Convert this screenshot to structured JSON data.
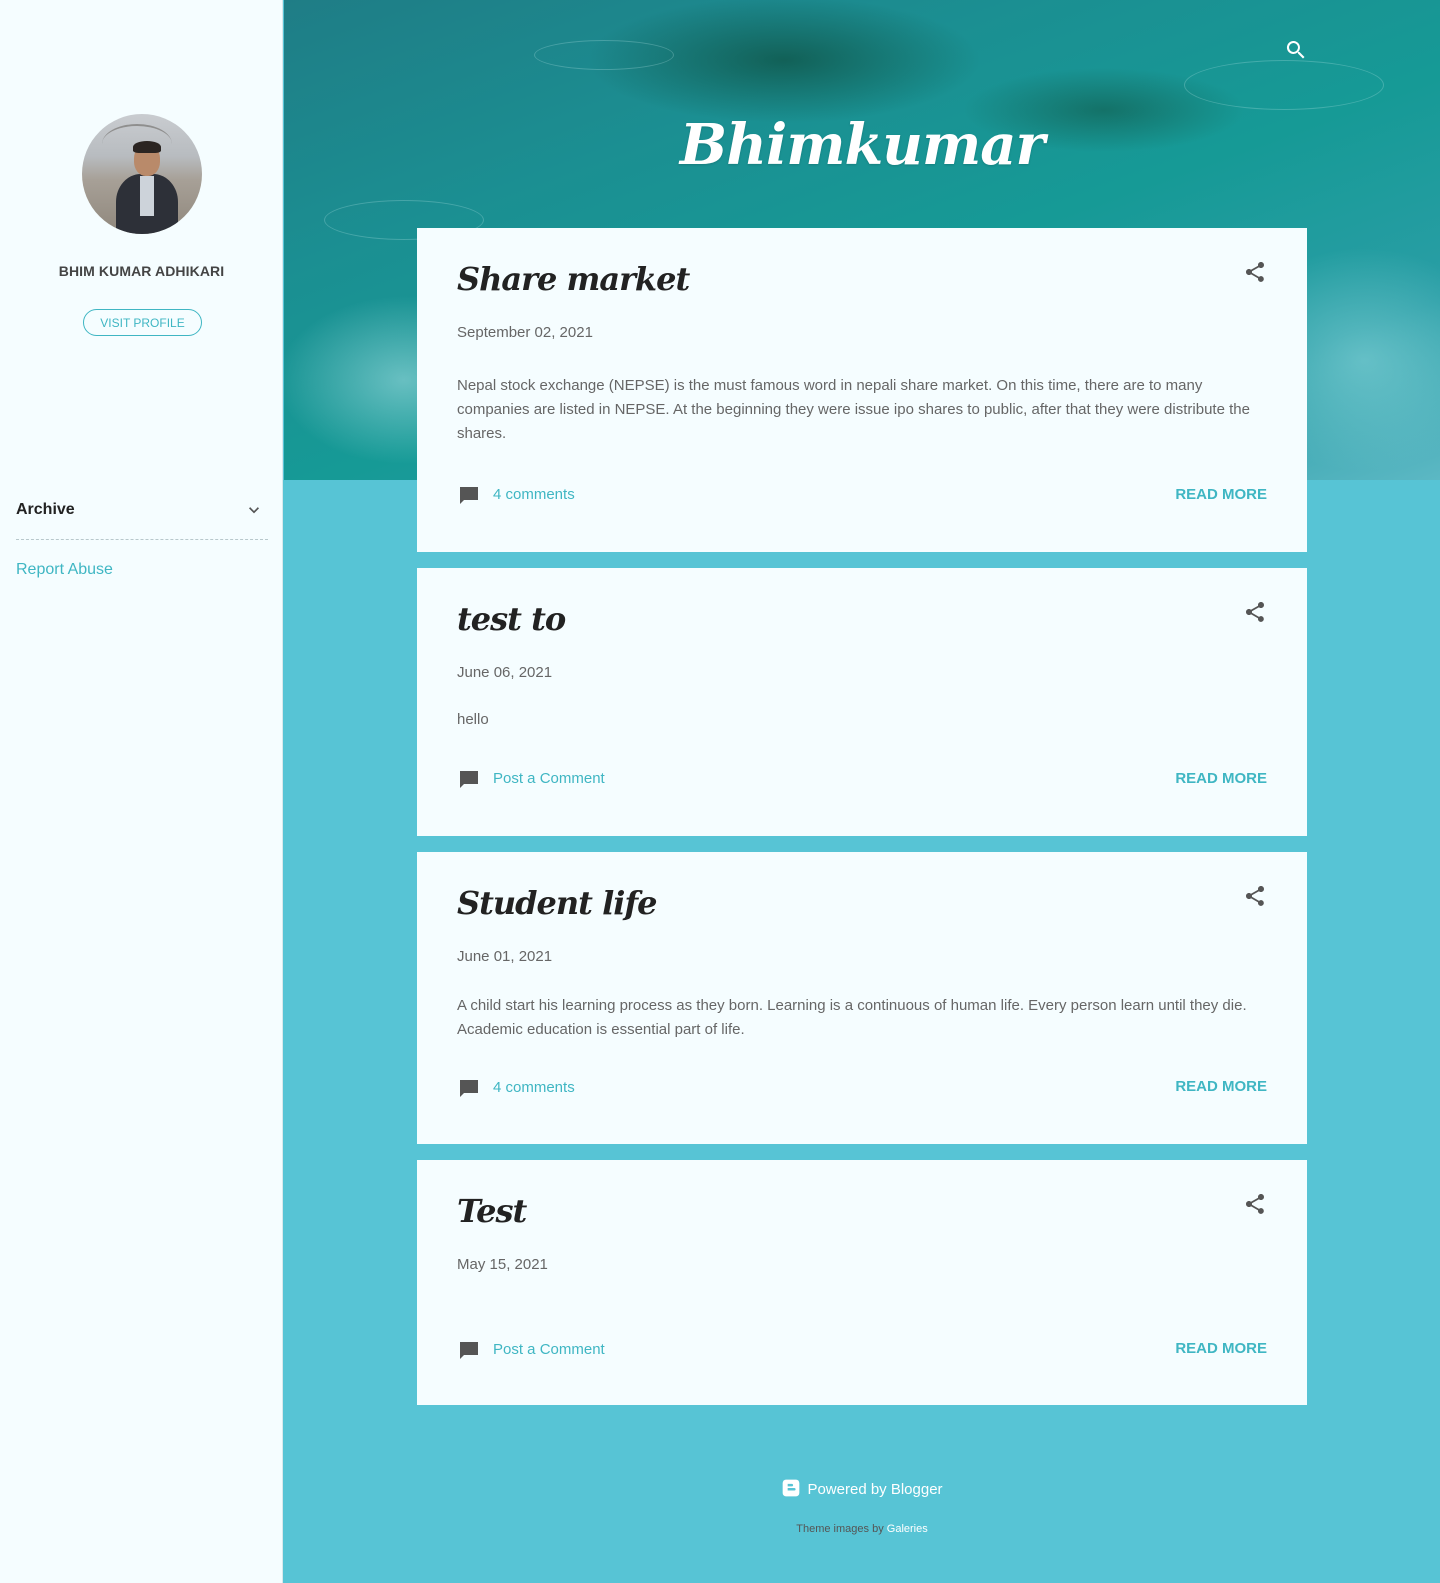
{
  "sidebar": {
    "profile_name": "BHIM KUMAR ADHIKARI",
    "visit_profile": "VISIT PROFILE",
    "archive_title": "Archive",
    "report_abuse": "Report Abuse"
  },
  "header": {
    "blog_title": "Bhimkumar"
  },
  "posts": [
    {
      "title": "Share market",
      "date": "September 02, 2021",
      "snippet": " Nepal stock exchange (NEPSE) is the must famous word in nepali share market. On this time, there are to many companies are listed in NEPSE. At the beginning they were issue ipo shares to public, after that they were distribute the shares.",
      "comments": "4 comments",
      "read_more": "READ MORE"
    },
    {
      "title": "test to",
      "date": "June 06, 2021",
      "snippet": "hello",
      "comments": "Post a Comment",
      "read_more": "READ MORE"
    },
    {
      "title": "Student life",
      "date": "June 01, 2021",
      "snippet": "A child  start his learning process as they born. Learning  is a continuous of human life. Every person learn until they die. Academic education is essential part of life.",
      "comments": "4 comments",
      "read_more": "READ MORE"
    },
    {
      "title": "Test",
      "date": "May 15, 2021",
      "snippet": "",
      "comments": "Post a Comment",
      "read_more": "READ MORE"
    }
  ],
  "footer": {
    "powered_by": "Powered by Blogger",
    "theme_images_by": "Theme images by",
    "theme_images_link": "Galeries"
  },
  "colors": {
    "accent": "#3fb6c3",
    "background": "#57c4d5",
    "card": "#f5fdff"
  }
}
